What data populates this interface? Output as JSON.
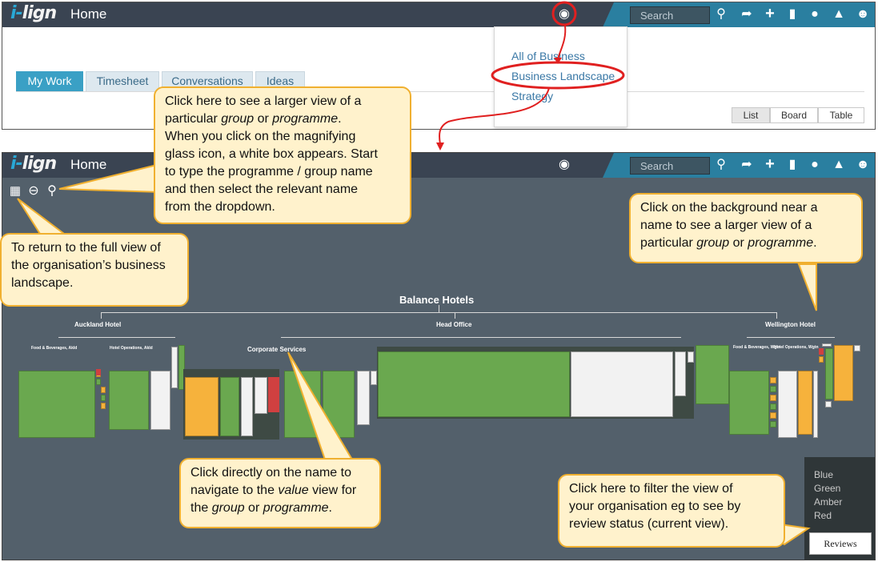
{
  "top": {
    "logo_prefix": "i-",
    "logo_main": "lign",
    "title": "Home",
    "search_placeholder": "Search",
    "tabs": [
      "My Work",
      "Timesheet",
      "Conversations",
      "Ideas"
    ],
    "views": [
      "List",
      "Board",
      "Table"
    ],
    "menu": [
      "All of Business",
      "Business Landscape",
      "Strategy"
    ]
  },
  "bottom": {
    "logo_prefix": "i-",
    "logo_main": "lign",
    "title": "Home",
    "search_placeholder": "Search"
  },
  "landscape": {
    "root": "Balance Hotels",
    "groups": [
      "Auckland Hotel",
      "Head Office",
      "Wellington Hotel"
    ],
    "sub_auckland": [
      "Food & Beverages, Akld",
      "Hotel Operations, Akld"
    ],
    "sub_head": "Corporate Services",
    "sub_wellington": [
      "Food & Beverages, Wgtn",
      "Hotel Operations, Wgtn"
    ]
  },
  "legend": {
    "items": [
      "Blue",
      "Green",
      "Amber",
      "Red"
    ],
    "button": "Reviews"
  },
  "callouts": {
    "zoom": [
      "Click here to see a larger view of a",
      "particular ",
      "group",
      " or ",
      "programme",
      ".",
      "When you click on the magnifying",
      "glass icon, a white box appears.  Start",
      "to type the programme / group name",
      "and then select the relevant name",
      "from the dropdown."
    ],
    "background": [
      "Click on the background near a",
      "name to see a larger view of a",
      "particular ",
      "group",
      " or ",
      "programme",
      "."
    ],
    "fullview": [
      "To return to the full view of",
      "the organisation’s business",
      "landscape."
    ],
    "name": [
      "Click directly on the name to",
      "navigate to the ",
      "value",
      " view for",
      "the ",
      "group",
      " or ",
      "programme",
      "."
    ],
    "filter": [
      "Click here to filter the view of",
      "your organisation eg to see by",
      "review status (current view)."
    ]
  },
  "colors": {
    "header": "#3a4452",
    "accent": "#2a7fa0",
    "landscape_bg": "#53606b",
    "callout": "#fff2cc",
    "callout_border": "#f0b030",
    "annotation": "#e02020"
  }
}
